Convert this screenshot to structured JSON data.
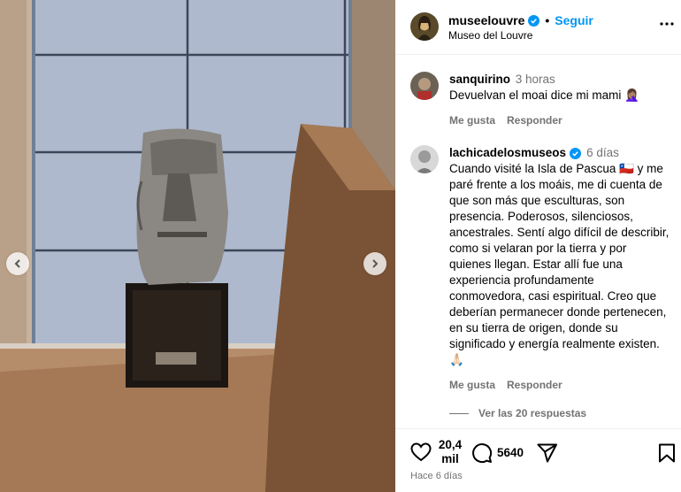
{
  "post": {
    "author": "museelouvre",
    "follow_label": "Seguir",
    "location": "Museo del Louvre"
  },
  "comments": [
    {
      "user": "sanquirino",
      "time": "3 horas",
      "text": "Devuelvan el moai dice mi mami 🤦🏽‍♀️",
      "like_label": "Me gusta",
      "reply_label": "Responder"
    },
    {
      "user": "lachicadelosmuseos",
      "verified": true,
      "time": "6 días",
      "text": "Cuando visité la Isla de Pascua 🇨🇱 y me paré frente a los moáis, me di cuenta de que son más que esculturas, son presencia. Poderosos, silenciosos, ancestrales. Sentí algo difícil de describir, como si velaran por la tierra y por quienes llegan. Estar allí fue una experiencia profundamente conmovedora, casi espiritual. Creo que deberían permanecer donde pertenecen, en su tierra de origen, donde su significado y energía realmente existen. 🙏🏻",
      "like_label": "Me gusta",
      "reply_label": "Responder",
      "replies_label": "Ver las 20 respuestas"
    }
  ],
  "footer": {
    "likes": "20,4 mil",
    "comments_count": "5640",
    "date": "Hace 6 días"
  },
  "icons": {
    "verified": "verified-badge-icon",
    "more": "more-options-icon",
    "like": "heart-icon",
    "comment": "comment-bubble-icon",
    "share": "paper-plane-icon",
    "save": "bookmark-icon",
    "prev": "chevron-left-icon",
    "next": "chevron-right-icon"
  },
  "colors": {
    "accent": "#0095f6",
    "verified": "#0095f6",
    "muted": "#737373"
  }
}
